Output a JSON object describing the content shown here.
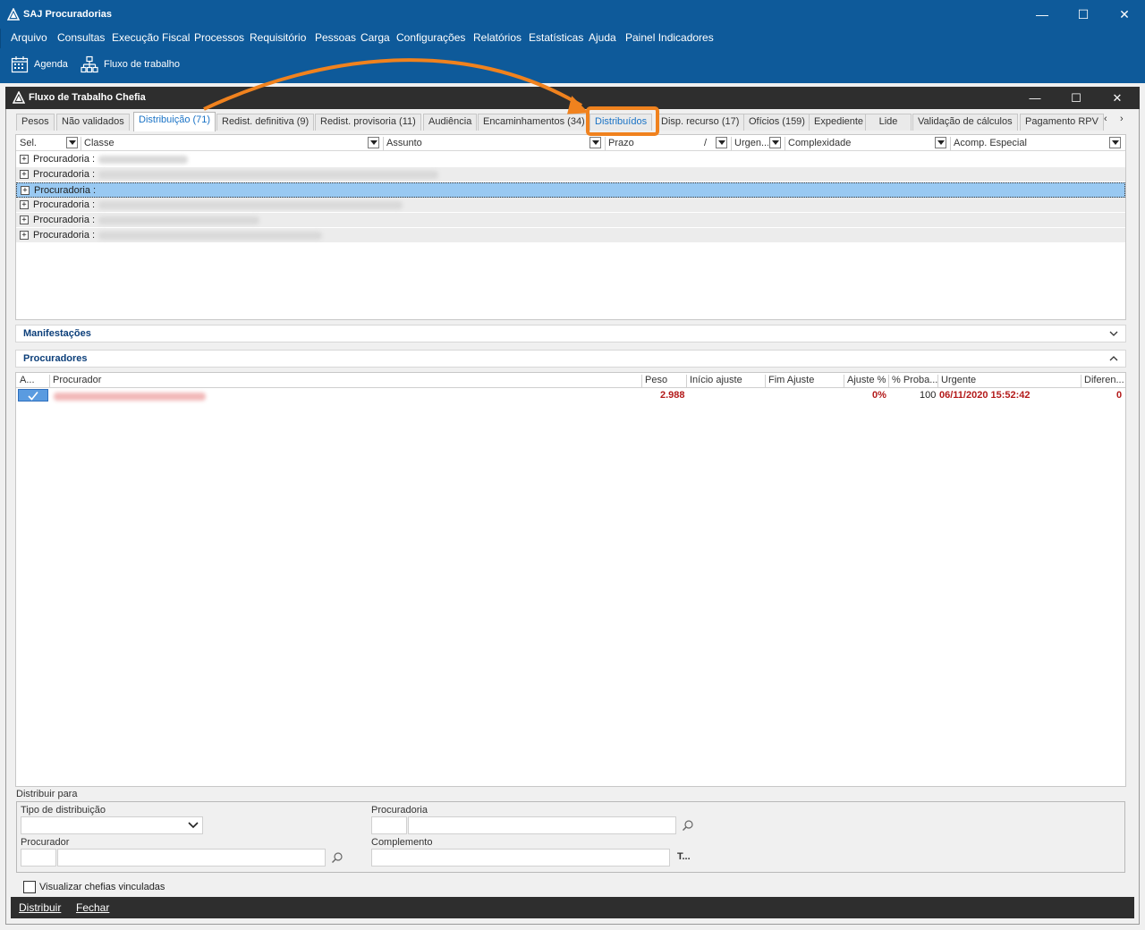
{
  "app": {
    "title": "SAJ Procuradorias",
    "minimize": "—",
    "maximize": "☐",
    "close": "✕"
  },
  "menu": [
    "Arquivo",
    "Consultas",
    "Execução Fiscal",
    "Processos",
    "Requisitório",
    "Pessoas",
    "Carga",
    "Configurações",
    "Relatórios",
    "Estatísticas",
    "Ajuda",
    "Painel Indicadores"
  ],
  "toolbar": {
    "agenda": "Agenda",
    "fluxo": "Fluxo de trabalho"
  },
  "window": {
    "title": "Fluxo de Trabalho Chefia"
  },
  "tabs": [
    {
      "label": "Pesos",
      "active": false
    },
    {
      "label": "Não validados",
      "active": false
    },
    {
      "label": "Distribuição (71)",
      "active": true
    },
    {
      "label": "Redist. definitiva (9)",
      "active": false
    },
    {
      "label": "Redist. provisoria (11)",
      "active": false
    },
    {
      "label": "Audiência",
      "active": false
    },
    {
      "label": "Encaminhamentos (34)",
      "active": false
    },
    {
      "label": "Distribuídos",
      "active": false
    },
    {
      "label": "Disp. recurso (17)",
      "active": false
    },
    {
      "label": "Ofícios (159)",
      "active": false
    },
    {
      "label": "Expediente",
      "active": false
    },
    {
      "label": "Lide",
      "active": false
    },
    {
      "label": "Validação de cálculos",
      "active": false
    },
    {
      "label": "Pagamento RPV",
      "active": false
    }
  ],
  "tab_nav": {
    "prev": "‹",
    "next": "›"
  },
  "grid": {
    "columns": [
      "Sel.",
      "Classe",
      "Assunto",
      "Prazo",
      "/",
      "Urgen...",
      "Complexidade",
      "Acomp. Especial"
    ],
    "rows": [
      {
        "label": "Procuradoria :",
        "selected": false
      },
      {
        "label": "Procuradoria :",
        "selected": false
      },
      {
        "label": "Procuradoria :",
        "selected": true
      },
      {
        "label": "Procuradoria :",
        "selected": false
      },
      {
        "label": "Procuradoria :",
        "selected": false
      },
      {
        "label": "Procuradoria :",
        "selected": false
      }
    ]
  },
  "sections": {
    "manifestacoes": "Manifestações",
    "procuradores": "Procuradores"
  },
  "procuradores": {
    "columns": [
      "A...",
      "Procurador",
      "Peso",
      "Início ajuste",
      "Fim Ajuste",
      "Ajuste %",
      "% Proba...",
      "Urgente",
      "Diferen..."
    ],
    "row": {
      "peso": "2.988",
      "ajuste": "0%",
      "proba": "100",
      "urgente": "06/11/2020 15:52:42",
      "diferenca": "0"
    }
  },
  "distribuir": {
    "label": "Distribuir para",
    "tipo_label": "Tipo de distribuição",
    "procuradoria_label": "Procuradoria",
    "procurador_label": "Procurador",
    "complemento_label": "Complemento",
    "t_button": "T..."
  },
  "footer": {
    "visualizar": "Visualizar chefias vinculadas",
    "distribuir": "Distribuir",
    "fechar": "Fechar"
  },
  "colors": {
    "titlebar": "#0e5a9a",
    "dark": "#2e2e2e",
    "accent": "#1a73c6",
    "annotation": "#f0821e",
    "value_red": "#b31a1a"
  }
}
